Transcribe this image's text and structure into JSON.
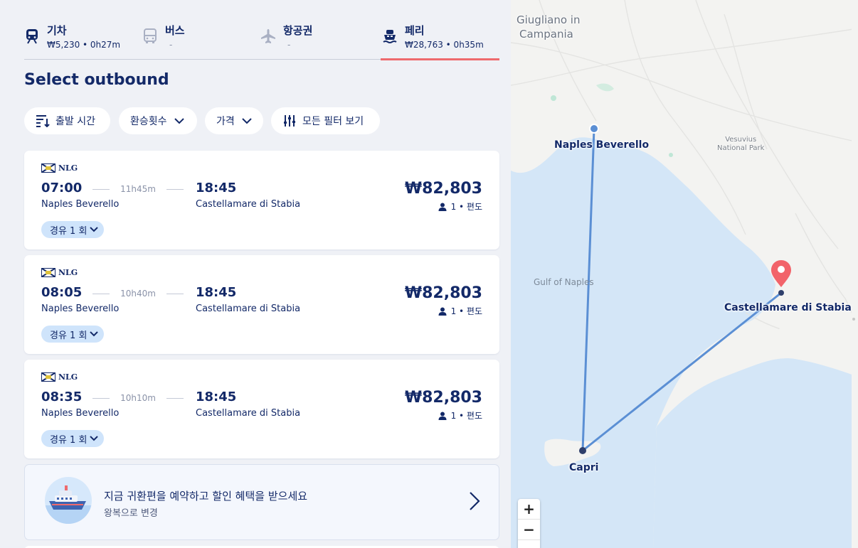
{
  "tabs": [
    {
      "name": "기차",
      "sub": "₩5,230 • 0h27m",
      "icon": "train-icon",
      "active": false
    },
    {
      "name": "버스",
      "sub": "-",
      "icon": "bus-icon",
      "active": false
    },
    {
      "name": "항공권",
      "sub": "-",
      "icon": "plane-icon",
      "active": false
    },
    {
      "name": "페리",
      "sub": "₩28,763 • 0h35m",
      "icon": "ferry-icon",
      "active": true
    }
  ],
  "page_title": "Select outbound",
  "filters": {
    "departure_time": "출발 시간",
    "transfers": "환승횟수",
    "price": "가격",
    "all_filters": "모든 필터 보기"
  },
  "results": [
    {
      "operator": "NLG",
      "dep_time": "07:00",
      "duration": "11h45m",
      "arr_time": "18:45",
      "from": "Naples Beverello",
      "to": "Castellamare di Stabia",
      "stops": "경유 1 회",
      "price": "₩82,803",
      "pax": "1 • 편도"
    },
    {
      "operator": "NLG",
      "dep_time": "08:05",
      "duration": "10h40m",
      "arr_time": "18:45",
      "from": "Naples Beverello",
      "to": "Castellamare di Stabia",
      "stops": "경유 1 회",
      "price": "₩82,803",
      "pax": "1 • 편도"
    },
    {
      "operator": "NLG",
      "dep_time": "08:35",
      "duration": "10h10m",
      "arr_time": "18:45",
      "from": "Naples Beverello",
      "to": "Castellamare di Stabia",
      "stops": "경유 1 회",
      "price": "₩82,803",
      "pax": "1 • 편도"
    }
  ],
  "promo": {
    "title": "지금 귀환편을 예약하고 할인 혜택을 받으세요",
    "subtitle": "왕복으로 변경"
  },
  "map": {
    "labels": {
      "giugliano_line1": "Giugliano in",
      "giugliano_line2": "Campania",
      "naples": "Naples Beverello",
      "vesuvius_line1": "Vesuvius",
      "vesuvius_line2": "National Park",
      "gulf": "Gulf of Naples",
      "castellamare": "Castellamare di Stabia",
      "capri": "Capri"
    },
    "zoom_in": "+",
    "zoom_out": "−",
    "colors": {
      "route": "#5b8fd4",
      "pin": "#f2636a",
      "sea": "#d4e6f7",
      "land": "#f3f3f1"
    }
  },
  "colors": {
    "brand_navy": "#132968",
    "active_tab_underline": "#ee6a6d",
    "stops_badge": "#cfe4fb",
    "background": "#eff1f6"
  }
}
